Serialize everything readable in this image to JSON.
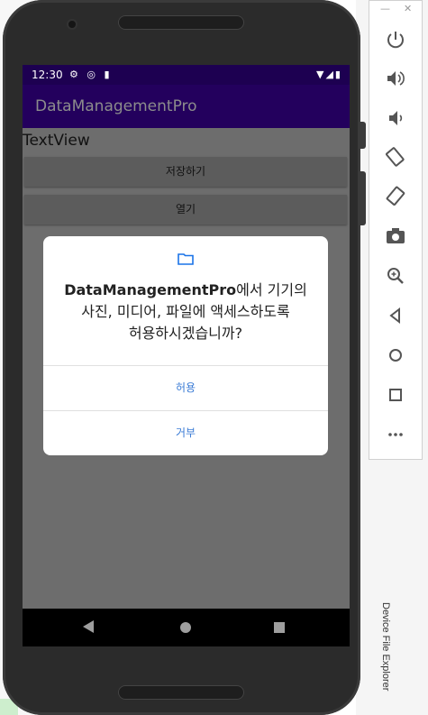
{
  "app": {
    "title": "DataManagementPro",
    "time": "12:30"
  },
  "screen": {
    "textview": "TextView",
    "save_button": "저장하기",
    "open_button": "열기"
  },
  "dialog": {
    "app_name": "DataManagementPro",
    "message_line1_suffix": "에서 기기의",
    "message_line2": "사진, 미디어, 파일에 액세스하도록",
    "message_line3": "허용하시겠습니까?",
    "allow": "허용",
    "deny": "거부"
  },
  "emulator": {
    "device_file_explorer": "Device File Explorer"
  },
  "colors": {
    "status_bar": "#1d0051",
    "app_bar": "#23005d",
    "dialog_button": "#3a7bd5"
  }
}
